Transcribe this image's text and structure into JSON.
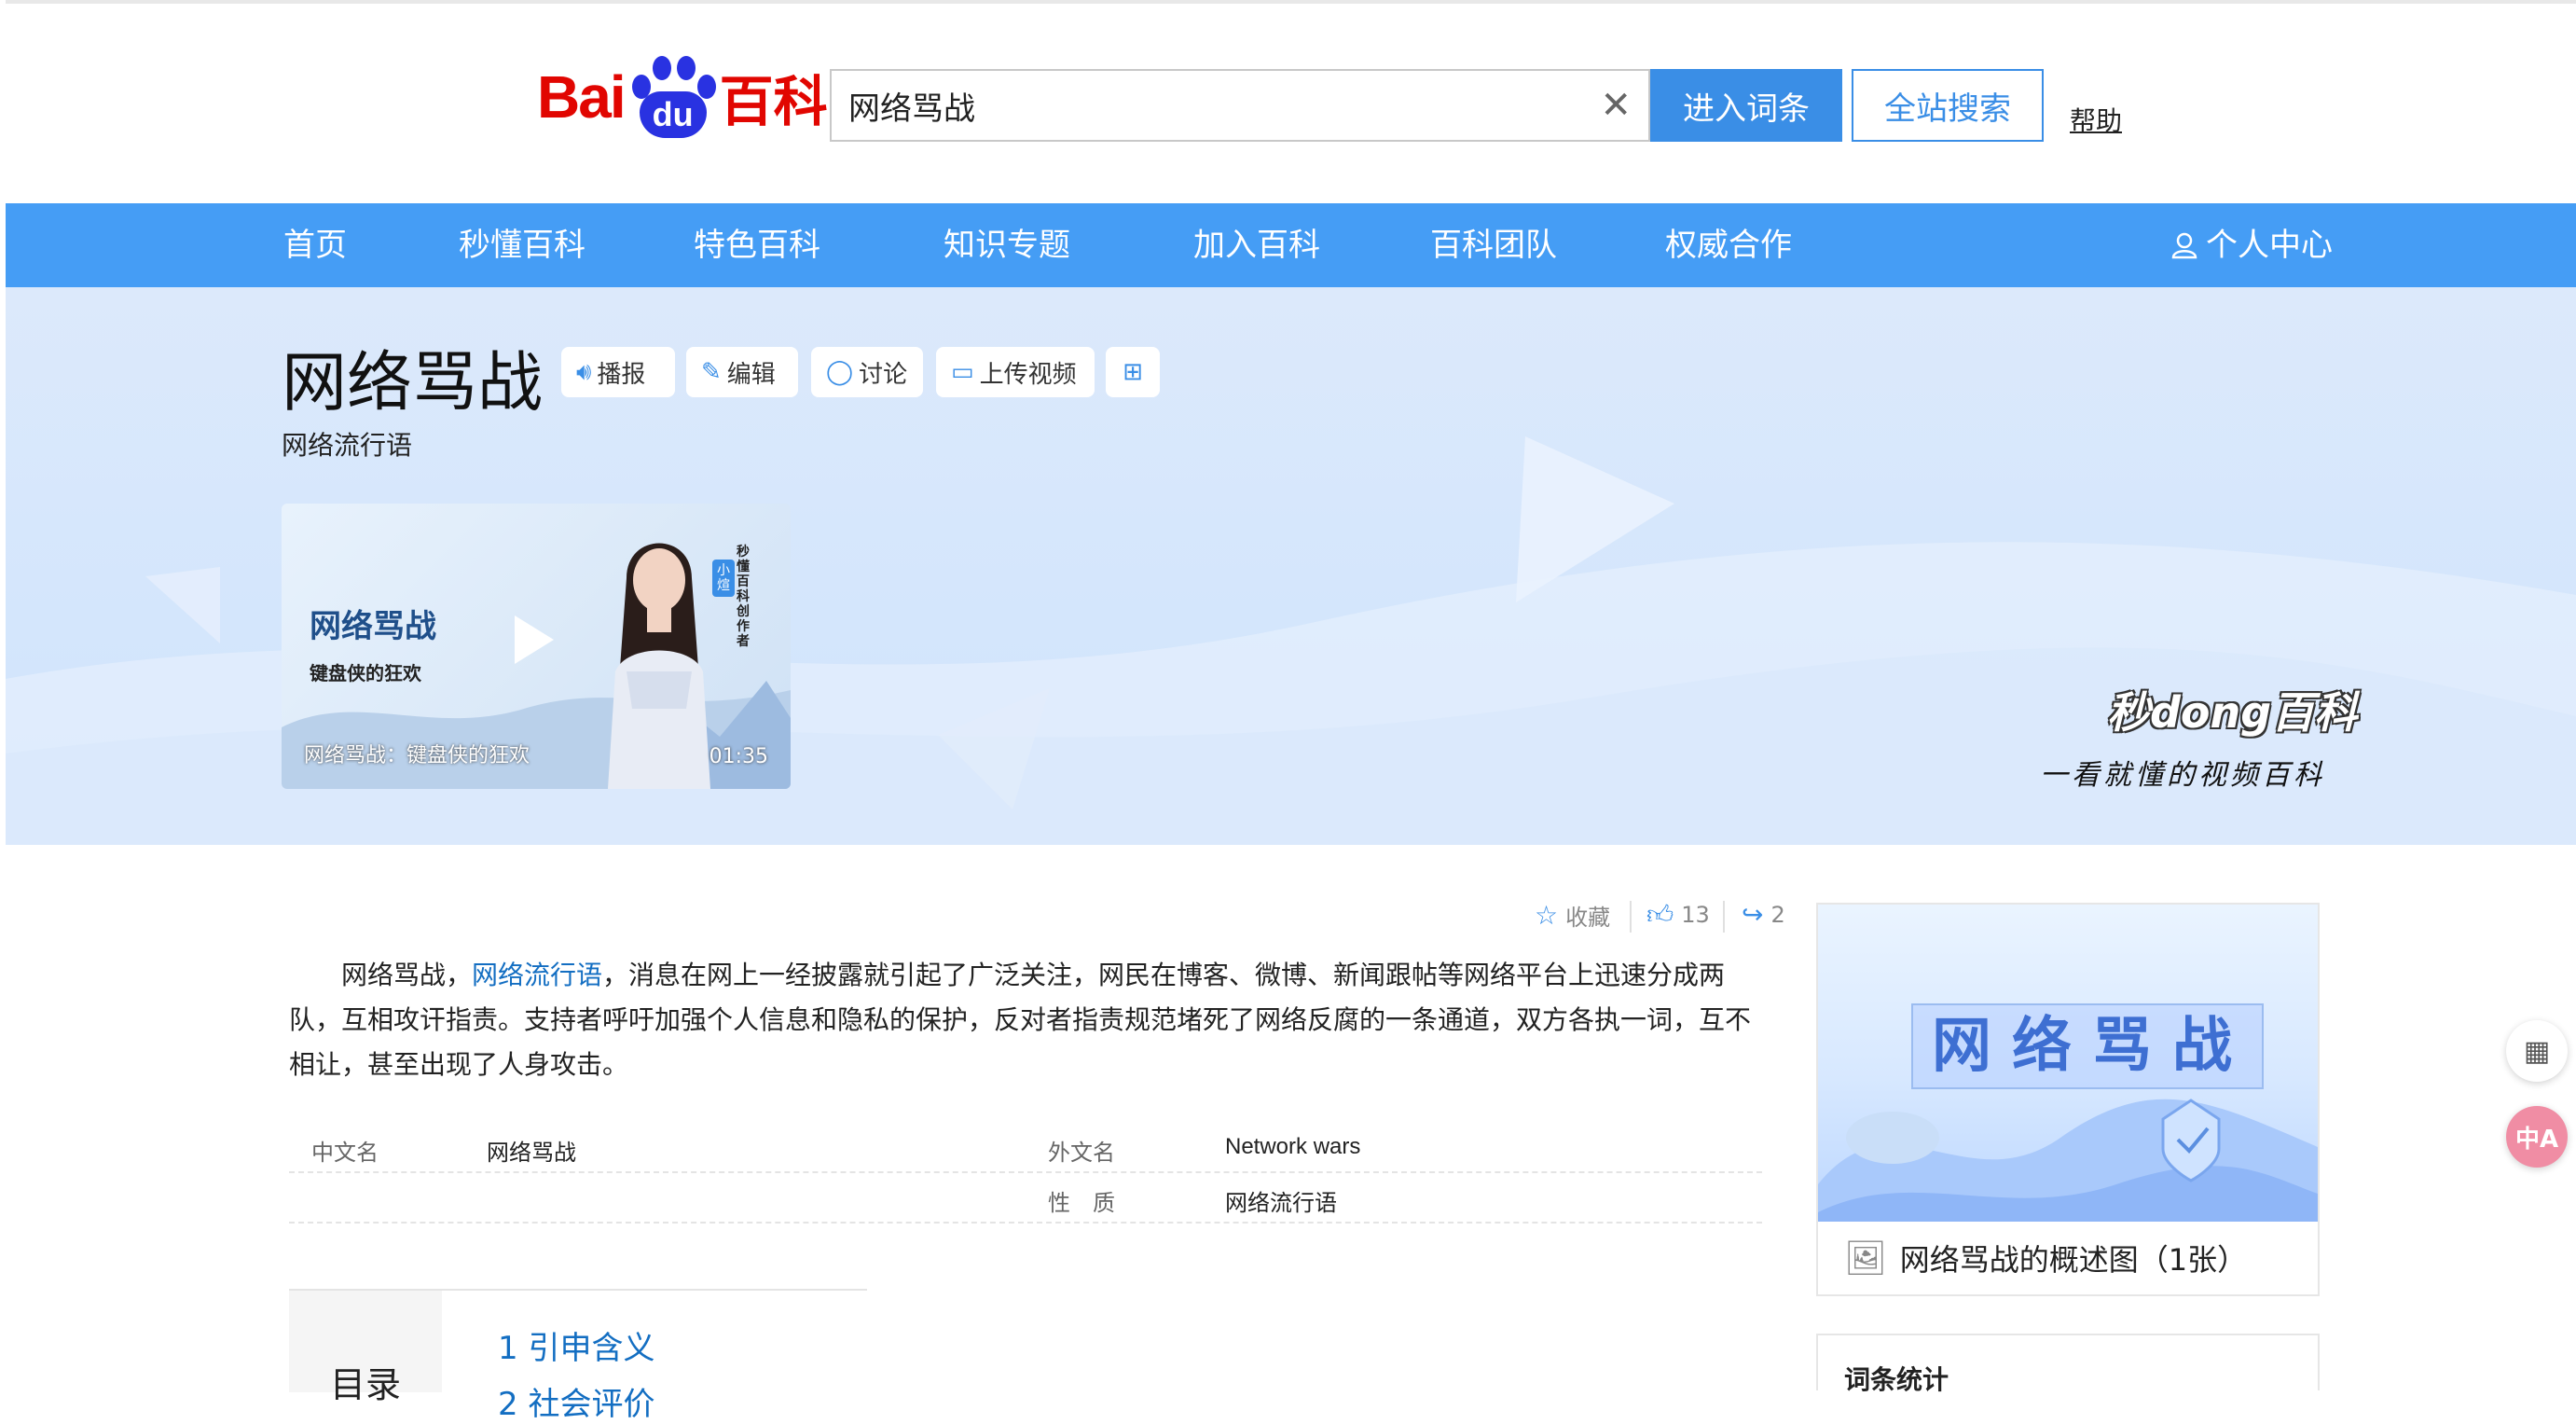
{
  "header": {
    "logo_bai": "Bai",
    "logo_du": "du",
    "logo_baike": "百科",
    "search_value": "网络骂战",
    "enter_button": "进入词条",
    "site_search_button": "全站搜索",
    "help_link": "帮助"
  },
  "nav": {
    "items": [
      "首页",
      "秒懂百科",
      "特色百科",
      "知识专题",
      "加入百科",
      "百科团队",
      "权威合作"
    ],
    "user_center": "个人中心"
  },
  "entry": {
    "title": "网络骂战",
    "subtitle": "网络流行语",
    "actions": {
      "broadcast": "播报",
      "edit": "编辑",
      "discuss": "讨论",
      "upload_video": "上传视频"
    }
  },
  "video": {
    "title": "网络骂战",
    "subtitle": "键盘侠的狂欢",
    "caption": "网络骂战：键盘侠的狂欢",
    "duration": "01:35",
    "creator_badge": "小煊",
    "creator_tag": "秒懂百科创作者"
  },
  "brand": {
    "miaodong": "秒dong百科",
    "slogan": "一看就懂的视频百科"
  },
  "stats_bar": {
    "favorite": "收藏",
    "likes": "13",
    "shares": "2"
  },
  "summary": {
    "before_link": "网络骂战，",
    "link": "网络流行语",
    "after_link": "，消息在网上一经披露就引起了广泛关注，网民在博客、微博、新闻跟帖等网络平台上迅速分成两队，互相攻讦指责。支持者呼吁加强个人信息和隐私的保护，反对者指责规范堵死了网络反腐的一条通道，双方各执一词，互不相让，甚至出现了人身攻击。"
  },
  "basic_info": {
    "chinese_name_label": "中文名",
    "chinese_name": "网络骂战",
    "foreign_name_label": "外文名",
    "foreign_name": "Network wars",
    "nature_label": "性　质",
    "nature": "网络流行语"
  },
  "toc": {
    "label": "目录",
    "items": [
      "1  引申含义",
      "2  社会评价"
    ]
  },
  "album": {
    "image_text": "网络骂战",
    "caption": "网络骂战的概述图（1张）"
  },
  "entry_stats": {
    "title": "词条统计"
  },
  "colors": {
    "nav_blue": "#459df5",
    "brand_red": "#e10601",
    "brand_blue": "#2932e1",
    "link_blue": "#136ec2"
  }
}
